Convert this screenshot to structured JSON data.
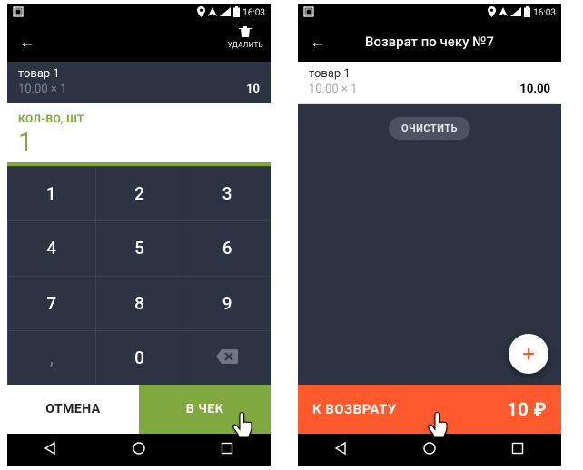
{
  "status": {
    "time": "16:03"
  },
  "left": {
    "delete_label": "УДАЛИТЬ",
    "item": {
      "name": "товар 1",
      "qty_line": "10.00 × 1",
      "price": "10"
    },
    "qty_label": "КОЛ-ВО, ШТ",
    "qty_value": "1",
    "keypad": [
      "1",
      "2",
      "3",
      "4",
      "5",
      "6",
      "7",
      "8",
      "9",
      ",",
      "0",
      "⌫"
    ],
    "cancel": "ОТМЕНА",
    "add": "В ЧЕК"
  },
  "right": {
    "title": "Возврат по чеку №7",
    "item": {
      "name": "товар 1",
      "qty_line": "10.00 × 1",
      "price": "10.00"
    },
    "clear": "ОЧИСТИТЬ",
    "return_label": "К ВОЗВРАТУ",
    "return_amount": "10 ₽"
  }
}
